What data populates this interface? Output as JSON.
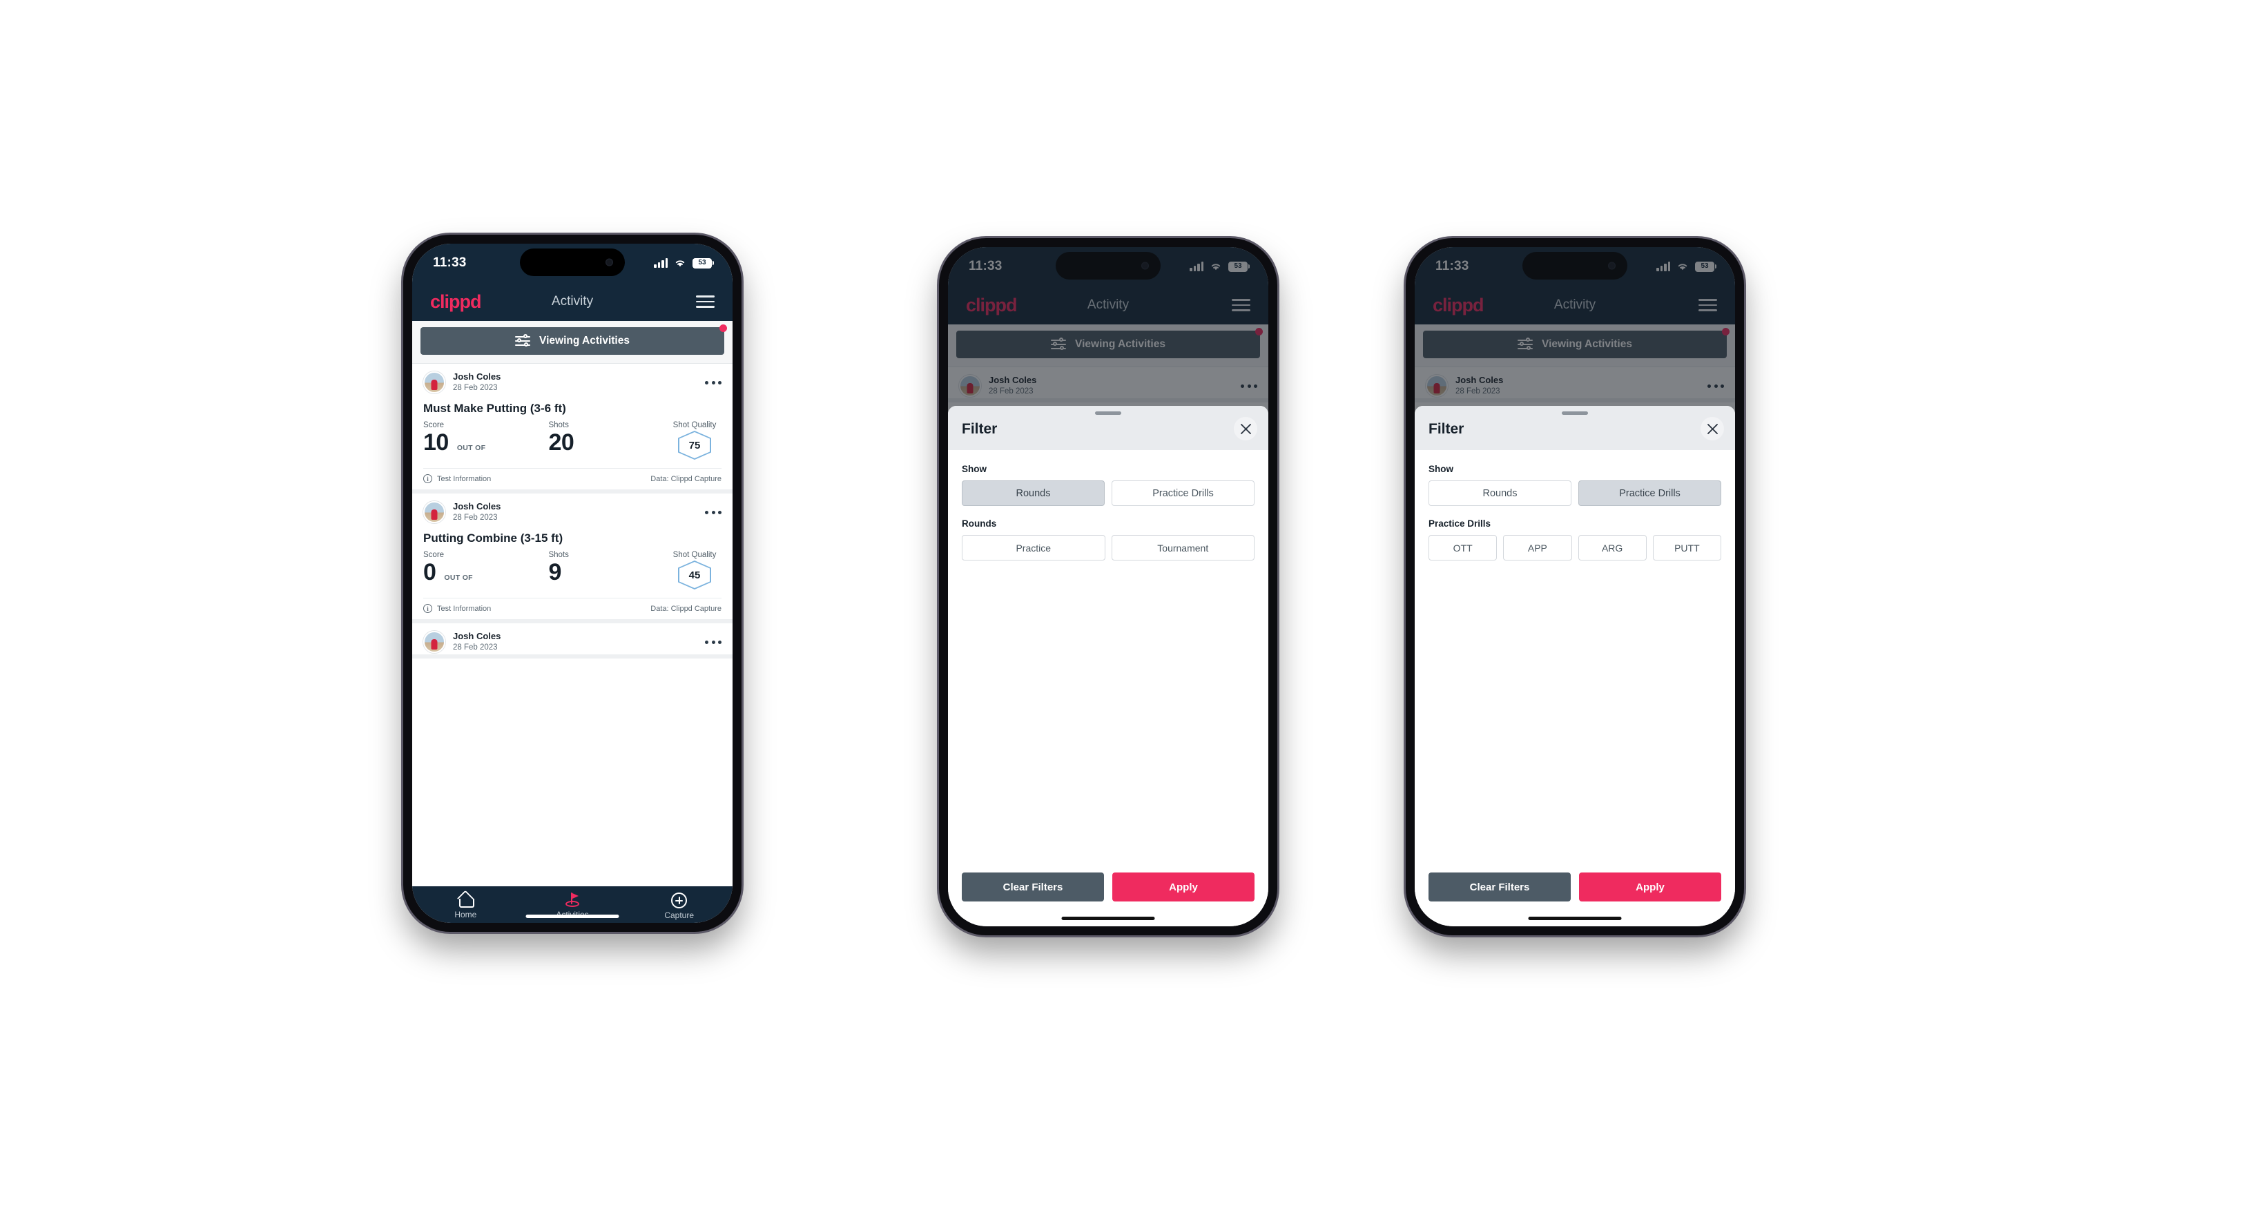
{
  "status_bar": {
    "time": "11:33",
    "battery": "53",
    "signal_icon": "signal-bars-icon",
    "wifi_icon": "wifi-icon"
  },
  "app_header": {
    "logo": "clippd",
    "title": "Activity",
    "menu_icon": "hamburger-menu-icon"
  },
  "filter_bar": {
    "label": "Viewing Activities",
    "icon": "sliders-filter-icon",
    "has_badge": true
  },
  "feed": {
    "cards": [
      {
        "user": "Josh Coles",
        "date": "28 Feb 2023",
        "title": "Must Make Putting (3-6 ft)",
        "score_label": "Score",
        "score_value": "10",
        "out_of": "OUT OF",
        "shots_label": "Shots",
        "shots_value": "20",
        "quality_label": "Shot Quality",
        "quality_value": "75",
        "footer_left": "Test Information",
        "footer_right": "Data: Clippd Capture"
      },
      {
        "user": "Josh Coles",
        "date": "28 Feb 2023",
        "title": "Putting Combine (3-15 ft)",
        "score_label": "Score",
        "score_value": "0",
        "out_of": "OUT OF",
        "shots_label": "Shots",
        "shots_value": "9",
        "quality_label": "Shot Quality",
        "quality_value": "45",
        "footer_left": "Test Information",
        "footer_right": "Data: Clippd Capture"
      },
      {
        "user": "Josh Coles",
        "date": "28 Feb 2023"
      }
    ]
  },
  "tab_bar": {
    "tabs": [
      {
        "label": "Home",
        "icon": "home-icon",
        "active": false
      },
      {
        "label": "Activities",
        "icon": "golf-flag-icon",
        "active": true
      },
      {
        "label": "Capture",
        "icon": "plus-circle-icon",
        "active": false
      }
    ]
  },
  "filter_sheet_rounds": {
    "title": "Filter",
    "close_icon": "close-x-icon",
    "show_label": "Show",
    "show_options": [
      {
        "label": "Rounds",
        "selected": true
      },
      {
        "label": "Practice Drills",
        "selected": false
      }
    ],
    "section_label": "Rounds",
    "section_options": [
      {
        "label": "Practice",
        "selected": false
      },
      {
        "label": "Tournament",
        "selected": false
      }
    ],
    "clear_label": "Clear Filters",
    "apply_label": "Apply"
  },
  "filter_sheet_drills": {
    "title": "Filter",
    "close_icon": "close-x-icon",
    "show_label": "Show",
    "show_options": [
      {
        "label": "Rounds",
        "selected": false
      },
      {
        "label": "Practice Drills",
        "selected": true
      }
    ],
    "section_label": "Practice Drills",
    "section_options": [
      {
        "label": "OTT",
        "selected": false
      },
      {
        "label": "APP",
        "selected": false
      },
      {
        "label": "ARG",
        "selected": false
      },
      {
        "label": "PUTT",
        "selected": false
      }
    ],
    "clear_label": "Clear Filters",
    "apply_label": "Apply"
  },
  "colors": {
    "brand_pink": "#ef2b5f",
    "header_dark": "#14283a",
    "slate": "#4d5b66",
    "hex_blue": "#7cb3de"
  }
}
